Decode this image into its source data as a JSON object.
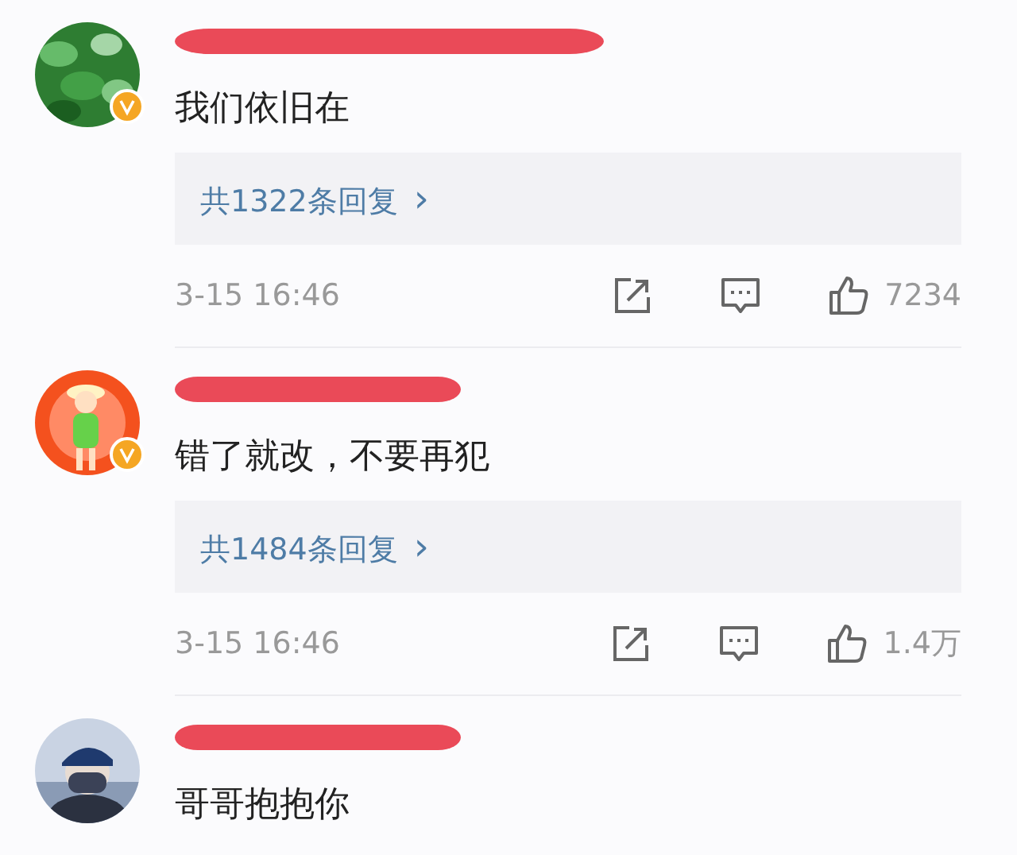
{
  "comments": [
    {
      "verified": true,
      "name_redacted": true,
      "text": "我们依旧在",
      "replies": "共1322条回复",
      "chevron": "›",
      "time": "3-15 16:46",
      "likes": "7234"
    },
    {
      "verified": true,
      "name_redacted": true,
      "text": "错了就改，不要再犯",
      "replies": "共1484条回复",
      "chevron": "›",
      "time": "3-15 16:46",
      "likes": "1.4万"
    },
    {
      "verified": false,
      "name_redacted": true,
      "text": "哥哥抱抱你"
    }
  ]
}
